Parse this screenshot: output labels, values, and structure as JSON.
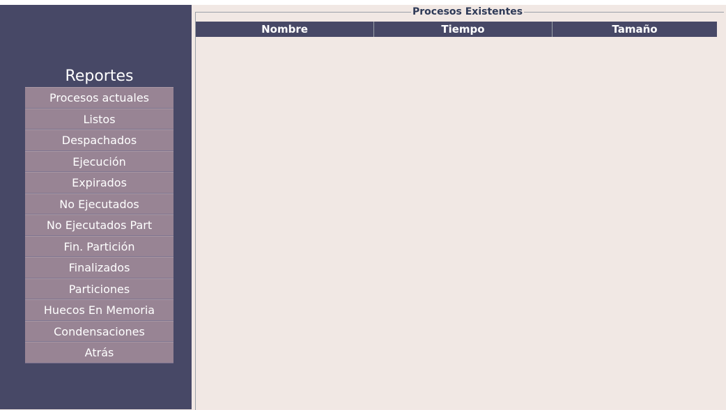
{
  "sidebar": {
    "title": "Reportes",
    "items": [
      {
        "label": "Procesos actuales"
      },
      {
        "label": "Listos"
      },
      {
        "label": "Despachados"
      },
      {
        "label": "Ejecución"
      },
      {
        "label": "Expirados"
      },
      {
        "label": "No Ejecutados"
      },
      {
        "label": "No Ejecutados Part"
      },
      {
        "label": "Fin. Partición"
      },
      {
        "label": "Finalizados"
      },
      {
        "label": "Particiones"
      },
      {
        "label": "Huecos En Memoria"
      },
      {
        "label": "Condensaciones"
      },
      {
        "label": "Atrás"
      }
    ]
  },
  "main": {
    "group_title": "Procesos Existentes",
    "table": {
      "columns": [
        "Nombre",
        "Tiempo",
        "Tamaño"
      ],
      "rows": []
    }
  },
  "colors": {
    "sidebar_bg": "#474866",
    "button_bg": "#988494",
    "content_bg": "#f1e8e4",
    "header_bg": "#474866"
  }
}
